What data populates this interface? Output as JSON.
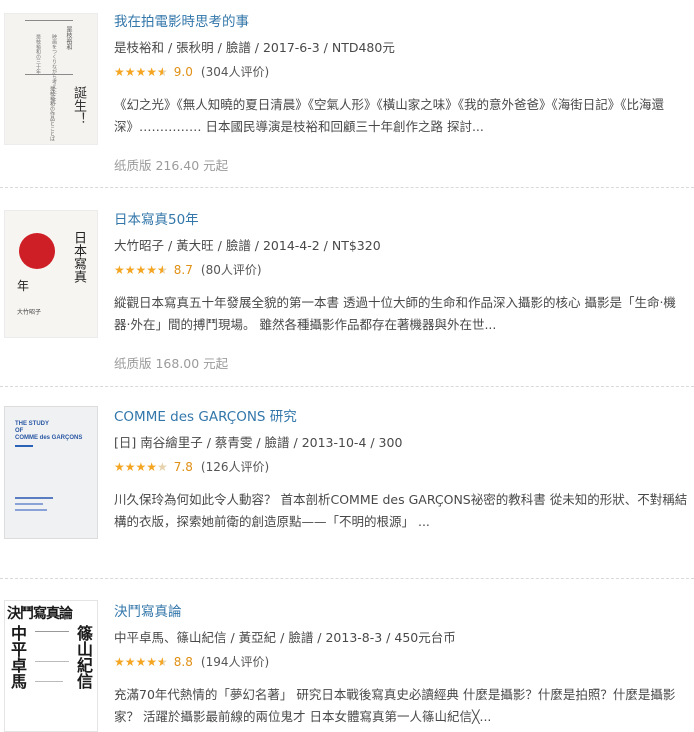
{
  "books": [
    {
      "title": "我在拍電影時思考的事",
      "meta": "是枝裕和 / 張秋明 / 臉譜 / 2017-6-3 / NTD480元",
      "stars": 4.5,
      "score": "9.0",
      "rating_count": "(304人评价)",
      "desc": "《幻之光》《無人知曉的夏日清晨》《空氣人形》《橫山家之味》《我的意外爸爸》《海街日記》《比海還深》…………… 日本國民導演是枝裕和回顧三十年創作之路 探討...",
      "price": "纸质版 216.40 元起",
      "cover_text": [
        "誕生！",
        "映畫"
      ]
    },
    {
      "title": "日本寫真50年",
      "meta": "大竹昭子 / 黃大旺 / 臉譜 / 2014-4-2 / NT$320",
      "stars": 4.5,
      "score": "8.7",
      "rating_count": "(80人评价)",
      "desc": "縱觀日本寫真五十年發展全貌的第一本書 透過十位大師的生命和作品深入攝影的核心 攝影是「生命‧機器‧外在」間的搏鬥現場。 雖然各種攝影作品都存在著機器與外在世...",
      "price": "纸质版 168.00 元起",
      "cover_text": [
        "日本寫真",
        "年",
        "大竹昭子"
      ]
    },
    {
      "title": "COMME des GARÇONS 研究",
      "meta": "[日] 南谷繪里子 / 蔡青雯 / 臉譜 / 2013-10-4 / 300",
      "stars": 4,
      "score": "7.8",
      "rating_count": "(126人评价)",
      "desc": "川久保玲為何如此令人動容？ 首本剖析COMME des GARÇONS祕密的教科書 從未知的形狀、不對稱結構的衣版，探索她前衛的創造原點——「不明的根源」 ...",
      "price": "",
      "cover_text": [
        "THE STUDY",
        "OF",
        "COMME des GARÇONS"
      ]
    },
    {
      "title": "決鬥寫真論",
      "meta": "中平卓馬、篠山紀信 / 黃亞紀 / 臉譜 / 2013-8-3 / 450元台币",
      "stars": 4.5,
      "score": "8.8",
      "rating_count": "(194人评价)",
      "desc": "充滿70年代熱情的「夢幻名著」 研究日本戰後寫真史必讀經典 什麼是攝影？什麼是拍照？什麼是攝影家？ 活躍於攝影最前線的兩位鬼才 日本女體寫真第一人篠山紀信╳...",
      "price": "",
      "cover_text": [
        "決鬥寫真論",
        "中平卓馬",
        "篠山紀信"
      ]
    }
  ],
  "colors": {
    "link": "#3377aa",
    "star": "#f4a623",
    "score": "#e09015"
  }
}
